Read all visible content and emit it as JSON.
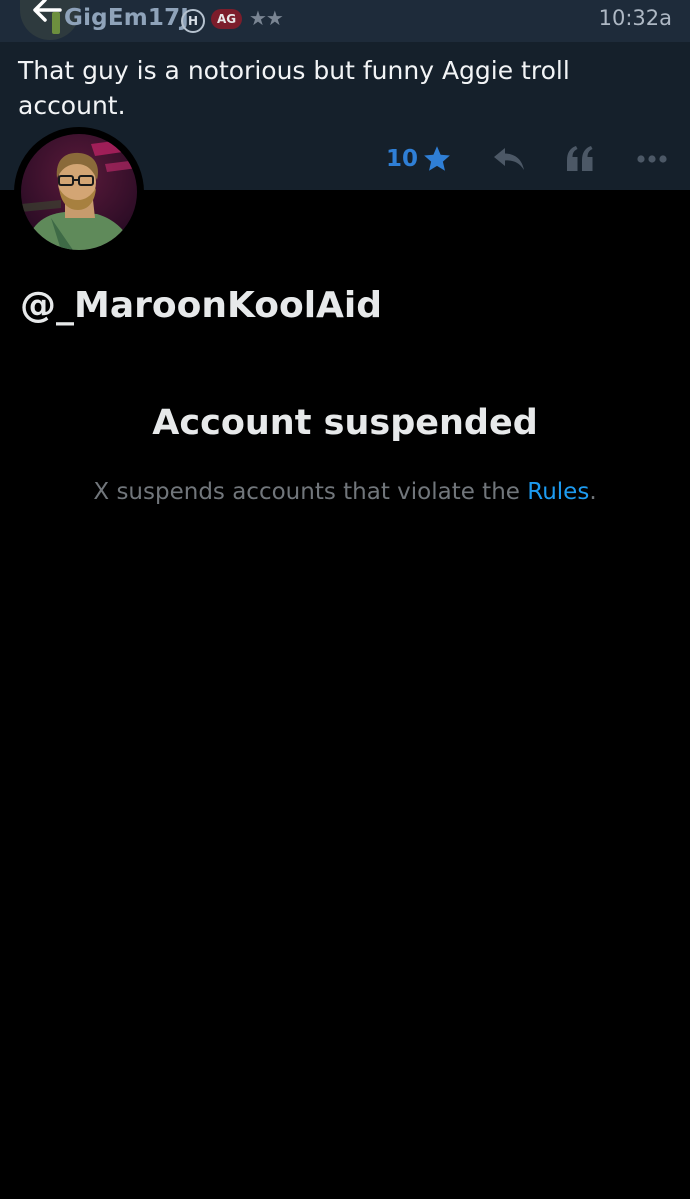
{
  "post": {
    "username": "GigEm17J",
    "badges": {
      "h": "H",
      "ag": "AG"
    },
    "rank_stars": "★★",
    "time": "10:32a",
    "text": "That guy is a notorious but funny Aggie troll account.",
    "like_count": "10"
  },
  "embed": {
    "handle": "@_MaroonKoolAid",
    "title": "Account suspended",
    "description_prefix": "X suspends accounts that violate the ",
    "rules_link": "Rules",
    "description_suffix": "."
  },
  "colors": {
    "header_bg": "#1e2b3a",
    "post_bg": "#15202b",
    "accent_blue": "#2f7fd6",
    "link_blue": "#1d9bf0",
    "aggie_maroon": "#7c1d2b",
    "muted_text": "#71767b"
  },
  "icons": {
    "back": "back-arrow-icon",
    "like": "star-icon",
    "reply": "reply-icon",
    "quote": "quote-icon",
    "more": "more-dots-icon"
  }
}
